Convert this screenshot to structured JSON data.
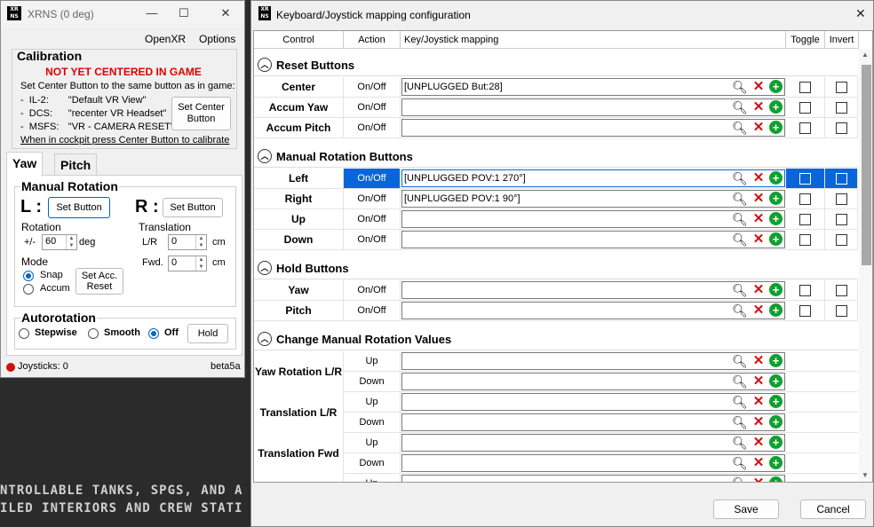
{
  "background": {
    "line1": "NTROLLABLE TANKS, SPGS, AND A",
    "line2": "ILED INTERIORS AND CREW STATI"
  },
  "main_window": {
    "logo": "XR NS",
    "title": "XRNS (0 deg)",
    "controls": {
      "minimize": "—",
      "maximize": "☐",
      "close": "✕"
    },
    "menu": {
      "openxr": "OpenXR",
      "options": "Options"
    },
    "calibration": {
      "title": "Calibration",
      "status": "NOT YET CENTERED IN GAME",
      "instruction": "Set Center Button to the same button as in game:",
      "games": [
        {
          "dash": "-",
          "game": "IL-2:",
          "value": "\"Default VR View\""
        },
        {
          "dash": "-",
          "game": "DCS:",
          "value": "\"recenter VR Headset\""
        },
        {
          "dash": "-",
          "game": "MSFS:",
          "value": "\"VR - CAMERA RESET\""
        }
      ],
      "set_center_button": "Set Center Button",
      "hint": "When in cockpit press Center Button to calibrate"
    },
    "tabs": [
      {
        "label": "Yaw"
      },
      {
        "label": "Pitch"
      }
    ],
    "manual_rotation": {
      "title": "Manual Rotation",
      "left_letter": "L :",
      "right_letter": "R :",
      "set_button": "Set Button",
      "rotation_label": "Rotation",
      "plusminus": "+/-",
      "rotation_value": "60",
      "deg": "deg",
      "translation_label": "Translation",
      "lr_label": "L/R",
      "lr_value": "0",
      "fwd_label": "Fwd.",
      "fwd_value": "0",
      "cm": "cm",
      "mode_label": "Mode",
      "mode_snap": "Snap",
      "mode_accum": "Accum",
      "mode_selected": "Snap",
      "set_acc_reset": "Set Acc. Reset"
    },
    "autorotation": {
      "title": "Autorotation",
      "options": [
        "Stepwise",
        "Smooth",
        "Off"
      ],
      "selected": "Off",
      "hold_button": "Hold"
    },
    "status": {
      "joysticks": "Joysticks: 0",
      "version": "beta5a",
      "indicator_color": "#d01010"
    }
  },
  "dialog": {
    "logo": "XR NS",
    "title": "Keyboard/Joystick mapping configuration",
    "close": "✕",
    "headers": {
      "control": "Control",
      "action": "Action",
      "mapping": "Key/Joystick mapping",
      "toggle": "Toggle",
      "invert": "Invert"
    },
    "sections": [
      {
        "title": "Reset Buttons",
        "rows": [
          {
            "control": "Center",
            "action": "On/Off",
            "mapping": "[UNPLUGGED But:28]"
          },
          {
            "control": "Accum Yaw",
            "action": "On/Off",
            "mapping": ""
          },
          {
            "control": "Accum Pitch",
            "action": "On/Off",
            "mapping": ""
          }
        ]
      },
      {
        "title": "Manual Rotation Buttons",
        "rows": [
          {
            "control": "Left",
            "action": "On/Off",
            "mapping": "[UNPLUGGED POV:1 270°]",
            "selected": true
          },
          {
            "control": "Right",
            "action": "On/Off",
            "mapping": "[UNPLUGGED POV:1 90°]"
          },
          {
            "control": "Up",
            "action": "On/Off",
            "mapping": ""
          },
          {
            "control": "Down",
            "action": "On/Off",
            "mapping": ""
          }
        ]
      },
      {
        "title": "Hold Buttons",
        "rows": [
          {
            "control": "Yaw",
            "action": "On/Off",
            "mapping": ""
          },
          {
            "control": "Pitch",
            "action": "On/Off",
            "mapping": ""
          }
        ]
      },
      {
        "title": "Change Manual Rotation Values",
        "groups": [
          {
            "label": "Yaw Rotation L/R",
            "actions": [
              "Up",
              "Down"
            ]
          },
          {
            "label": "Translation L/R",
            "actions": [
              "Up",
              "Down"
            ]
          },
          {
            "label": "Translation Fwd",
            "actions": [
              "Up",
              "Down"
            ]
          },
          {
            "label": "",
            "actions": [
              "Up"
            ]
          }
        ]
      }
    ],
    "buttons": {
      "save": "Save",
      "cancel": "Cancel"
    },
    "accent_color": "#0a66d8"
  }
}
